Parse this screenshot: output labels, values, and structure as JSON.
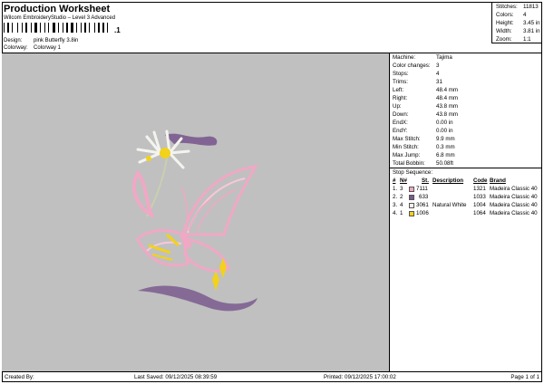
{
  "header": {
    "title": "Production Worksheet",
    "subtitle": "Wilcom EmbroideryStudio – Level 3 Advanced",
    "barcode_suffix": ",1"
  },
  "design": {
    "label": "Design:",
    "value": "pink Butterfly 3.8in"
  },
  "colorway": {
    "label": "Colorway:",
    "value": "Colorway 1"
  },
  "stats": [
    {
      "label": "Stitches:",
      "value": "11813"
    },
    {
      "label": "Colors:",
      "value": "4"
    },
    {
      "label": "Height:",
      "value": "3.45 in"
    },
    {
      "label": "Width:",
      "value": "3.81 in"
    },
    {
      "label": "Zoom:",
      "value": "1:1"
    }
  ],
  "machine_info": [
    {
      "label": "Machine:",
      "value": "Tajima"
    },
    {
      "label": "Color changes:",
      "value": "3"
    },
    {
      "label": "Stops:",
      "value": "4"
    },
    {
      "label": "Trims:",
      "value": "31"
    },
    {
      "label": "Left:",
      "value": "48.4 mm"
    },
    {
      "label": "Right:",
      "value": "48.4 mm"
    },
    {
      "label": "Up:",
      "value": "43.8 mm"
    },
    {
      "label": "Down:",
      "value": "43.8 mm"
    },
    {
      "label": "EndX:",
      "value": "0.00 in"
    },
    {
      "label": "EndY:",
      "value": "0.00 in"
    },
    {
      "label": "Max Stitch:",
      "value": "9.9 mm"
    },
    {
      "label": "Min Stitch:",
      "value": "0.3 mm"
    },
    {
      "label": "Max Jump:",
      "value": "6.8 mm"
    },
    {
      "label": "Total Bobbin:",
      "value": "50.08ft"
    }
  ],
  "stop_sequence": {
    "title": "Stop Sequence:",
    "headers": {
      "hash": "#",
      "n": "N#",
      "st": "St.",
      "desc": "Description",
      "code": "Code",
      "brand": "Brand"
    },
    "rows": [
      {
        "idx": "1.",
        "n": "3",
        "st": "7111",
        "desc": "",
        "count": "1321",
        "brand": "Madeira Classic 40",
        "color": "#f0a8c4"
      },
      {
        "idx": "2.",
        "n": "2",
        "st": "633",
        "desc": "",
        "count": "1033",
        "brand": "Madeira Classic 40",
        "color": "#7a5a8e"
      },
      {
        "idx": "3.",
        "n": "4",
        "st": "3061",
        "desc": "Natural White",
        "count": "1004",
        "brand": "Madeira Classic 40",
        "color": "#f4f4ee"
      },
      {
        "idx": "4.",
        "n": "1",
        "st": "1006",
        "desc": "",
        "count": "1064",
        "brand": "Madeira Classic 40",
        "color": "#f2d21a"
      }
    ]
  },
  "footer": {
    "created_by": "Created By:",
    "last_saved": "Last Saved: 09/12/2025 08:39:59",
    "printed": "Printed: 09/12/2025 17:00:02",
    "page": "Page 1 of 1"
  }
}
